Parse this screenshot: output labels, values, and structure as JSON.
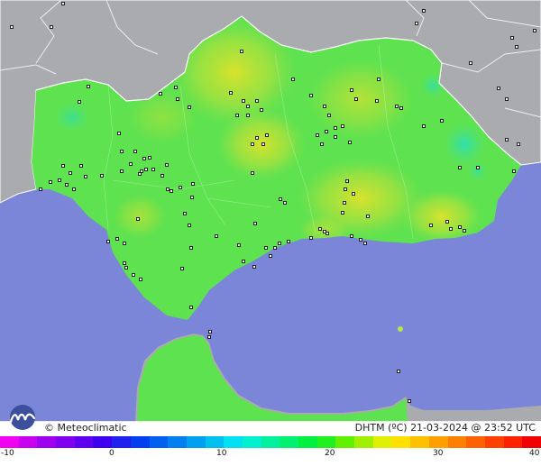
{
  "map": {
    "region": "Andalucía",
    "background_colors": {
      "sea": "#7b86d9",
      "outside_land": "#a9abae",
      "region_base": "#5ee24f"
    },
    "temperature_labels": []
  },
  "footer": {
    "brand": "© Meteoclimatic",
    "title": "DHTM (ºC)  21-03-2024 @ 23:52 UTC"
  },
  "scale": {
    "ticks": [
      "-10",
      "0",
      "10",
      "20",
      "30",
      "40"
    ],
    "colors": [
      "#f000f0",
      "#c800f0",
      "#a000f0",
      "#8000f0",
      "#6000f0",
      "#4000f0",
      "#2020f0",
      "#0040f0",
      "#0060f0",
      "#0080f0",
      "#00a0f0",
      "#00c0f0",
      "#00e0f0",
      "#00f0d0",
      "#00f0a0",
      "#00f070",
      "#00f040",
      "#20f020",
      "#60f000",
      "#a0f000",
      "#e0f000",
      "#ffe000",
      "#ffc000",
      "#ffa000",
      "#ff8000",
      "#ff6000",
      "#ff4000",
      "#ff2000",
      "#f00000"
    ]
  }
}
